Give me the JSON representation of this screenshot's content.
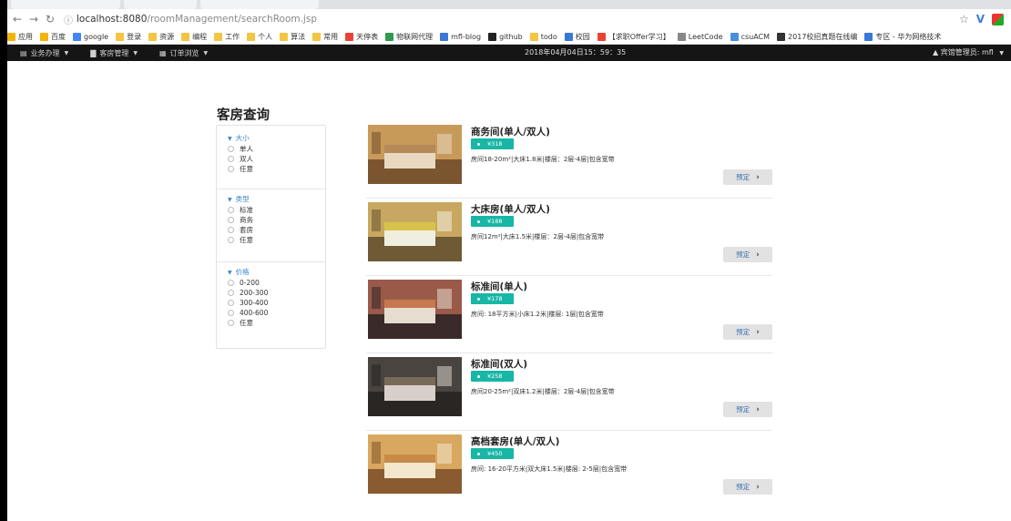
{
  "browser": {
    "url_host": "localhost:8080",
    "url_path": "/roomManagement/searchRoom.jsp",
    "bookmarks": [
      "应用",
      "百度",
      "google",
      "登录",
      "资源",
      "编程",
      "工作",
      "个人",
      "算法",
      "常用",
      "天停表",
      "物联网代理",
      "mfl-blog",
      "github",
      "todo",
      "校园",
      "【求职Offer学习】",
      "LeetCode",
      "csuACM",
      "2017校招真题在线编",
      "专区 - 华为网络技术"
    ]
  },
  "navbar": {
    "menus": [
      "业务办理",
      "客房管理",
      "订单浏览"
    ],
    "clock": "2018年04月04日15：59：35",
    "user": "宾馆管理员: mfl"
  },
  "page": {
    "title": "客房查询",
    "book_label": "预定"
  },
  "filters": [
    {
      "title": "大小",
      "options": [
        "单人",
        "双人",
        "任意"
      ]
    },
    {
      "title": "类型",
      "options": [
        "标准",
        "商务",
        "套房",
        "任意"
      ]
    },
    {
      "title": "价格",
      "options": [
        "0-200",
        "200-300",
        "300-400",
        "400-600",
        "任意"
      ]
    }
  ],
  "rooms": [
    {
      "name": "商务间(单人/双人)",
      "price": "¥318",
      "desc": "房间18-20m²|大床1.8米|楼层：2层-4层|包含宽带"
    },
    {
      "name": "大床房(单人/双人)",
      "price": "¥188",
      "desc": "房间12m²|大床1.5米|楼层：2层-4层|包含宽带"
    },
    {
      "name": "标准间(单人)",
      "price": "¥178",
      "desc": "房间: 18平方米|小床1.2米|楼层: 1层|包含宽带"
    },
    {
      "name": "标准间(双人)",
      "price": "¥258",
      "desc": "房间20-25m²|双床1.2米|楼层：2层-4层|包含宽带"
    },
    {
      "name": "高档套房(单人/双人)",
      "price": "¥450",
      "desc": "房间: 16-20平方米|双大床1.5米|楼层: 2-5层|包含宽带"
    }
  ],
  "colors": {
    "price_tag": "#17b6a5",
    "navbar": "#151515",
    "filter_title": "#3b83c8"
  }
}
